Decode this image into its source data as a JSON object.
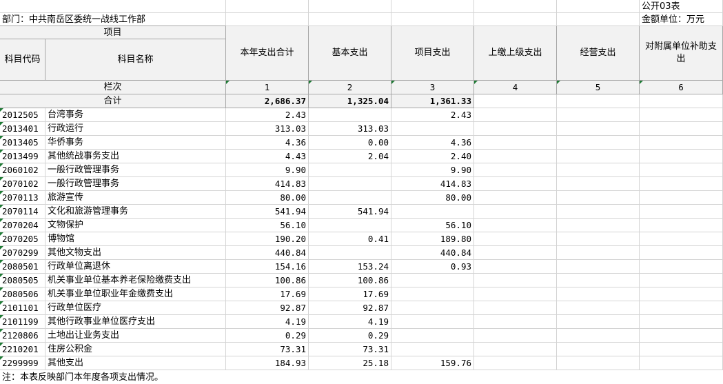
{
  "header": {
    "form_no": "公开03表",
    "department": "部门：中共南岳区委统一战线工作部",
    "unit": "金额单位：万元"
  },
  "columns": {
    "project": "项目",
    "code": "科目代码",
    "name": "科目名称",
    "total": "本年支出合计",
    "basic": "基本支出",
    "project_exp": "项目支出",
    "upper": "上缴上级支出",
    "business": "经营支出",
    "subsidiary": "对附属单位补助支出"
  },
  "index_row": {
    "label": "栏次",
    "nums": [
      "1",
      "2",
      "3",
      "4",
      "5",
      "6"
    ]
  },
  "total_row": {
    "label": "合计",
    "total": "2,686.37",
    "basic": "1,325.04",
    "project": "1,361.33"
  },
  "rows": [
    {
      "code": "2012505",
      "name": "台湾事务",
      "total": "2.43",
      "basic": "",
      "project": "2.43"
    },
    {
      "code": "2013401",
      "name": "行政运行",
      "total": "313.03",
      "basic": "313.03",
      "project": ""
    },
    {
      "code": "2013405",
      "name": "华侨事务",
      "total": "4.36",
      "basic": "0.00",
      "project": "4.36"
    },
    {
      "code": "2013499",
      "name": "其他统战事务支出",
      "total": "4.43",
      "basic": "2.04",
      "project": "2.40"
    },
    {
      "code": "2060102",
      "name": "一般行政管理事务",
      "total": "9.90",
      "basic": "",
      "project": "9.90"
    },
    {
      "code": "2070102",
      "name": "一般行政管理事务",
      "total": "414.83",
      "basic": "",
      "project": "414.83"
    },
    {
      "code": "2070113",
      "name": "旅游宣传",
      "total": "80.00",
      "basic": "",
      "project": "80.00"
    },
    {
      "code": "2070114",
      "name": "文化和旅游管理事务",
      "total": "541.94",
      "basic": "541.94",
      "project": ""
    },
    {
      "code": "2070204",
      "name": "文物保护",
      "total": "56.10",
      "basic": "",
      "project": "56.10"
    },
    {
      "code": "2070205",
      "name": "博物馆",
      "total": "190.20",
      "basic": "0.41",
      "project": "189.80"
    },
    {
      "code": "2070299",
      "name": "其他文物支出",
      "total": "440.84",
      "basic": "",
      "project": "440.84"
    },
    {
      "code": "2080501",
      "name": "行政单位离退休",
      "total": "154.16",
      "basic": "153.24",
      "project": "0.93"
    },
    {
      "code": "2080505",
      "name": "机关事业单位基本养老保险缴费支出",
      "total": "100.86",
      "basic": "100.86",
      "project": ""
    },
    {
      "code": "2080506",
      "name": "机关事业单位职业年金缴费支出",
      "total": "17.69",
      "basic": "17.69",
      "project": ""
    },
    {
      "code": "2101101",
      "name": "行政单位医疗",
      "total": "92.87",
      "basic": "92.87",
      "project": ""
    },
    {
      "code": "2101199",
      "name": "其他行政事业单位医疗支出",
      "total": "4.19",
      "basic": "4.19",
      "project": ""
    },
    {
      "code": "2120806",
      "name": "土地出让业务支出",
      "total": "0.29",
      "basic": "0.29",
      "project": ""
    },
    {
      "code": "2210201",
      "name": "住房公积金",
      "total": "73.31",
      "basic": "73.31",
      "project": ""
    },
    {
      "code": "2299999",
      "name": "其他支出",
      "total": "184.93",
      "basic": "25.18",
      "project": "159.76"
    }
  ],
  "note": "注：本表反映部门本年度各项支出情况。"
}
